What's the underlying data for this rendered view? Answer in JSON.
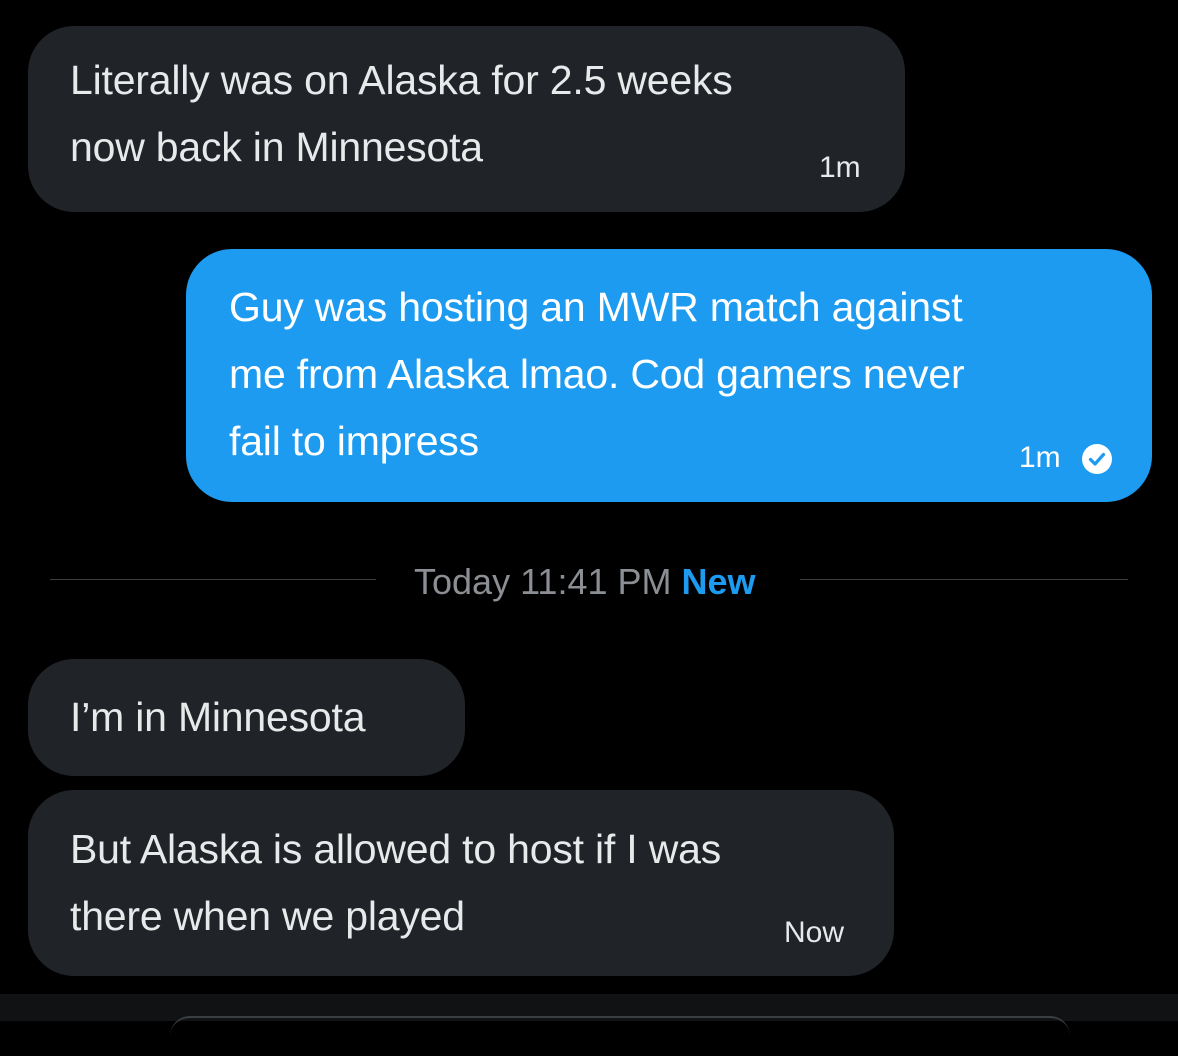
{
  "messages": [
    {
      "direction": "received",
      "text": "Literally was on Alaska for 2.5 weeks\nnow back in Minnesota",
      "time": "1m"
    },
    {
      "direction": "sent",
      "text": "Guy was hosting an MWR match against\nme from Alaska lmao.  Cod gamers never\nfail to impress",
      "time": "1m",
      "status_icon": "check-circle-icon"
    },
    {
      "direction": "received",
      "text": "I’m in Minnesota",
      "time": ""
    },
    {
      "direction": "received",
      "text": "But Alaska is allowed to host if I was\nthere when we played",
      "time": "Now"
    }
  ],
  "divider": {
    "label": "Today 11:41 PM",
    "new_label": "New"
  },
  "colors": {
    "background": "#000000",
    "received_bubble": "#202327",
    "sent_bubble": "#1d9bf0",
    "accent": "#1d9bf0",
    "muted_text": "#8b8f94"
  }
}
